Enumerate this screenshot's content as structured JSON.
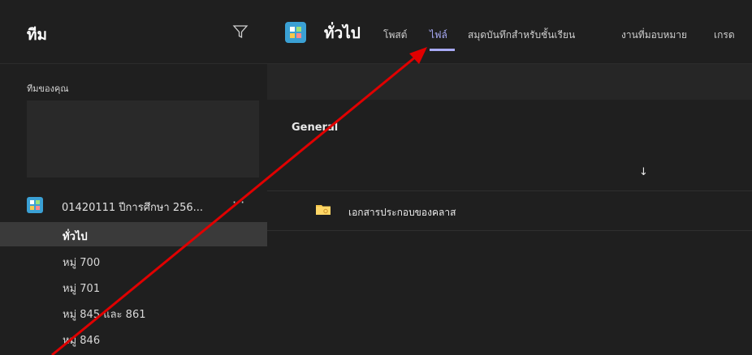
{
  "sidebar": {
    "title": "ทีม",
    "your_teams_label": "ทีมของคุณ",
    "team": {
      "name": "01420111 ปีการศึกษา 256...",
      "more": "···"
    },
    "channels": [
      {
        "label": "ทั่วไป",
        "active": true
      },
      {
        "label": "หมู่ 700",
        "active": false
      },
      {
        "label": "หมู่ 701",
        "active": false
      },
      {
        "label": "หมู่ 845 และ 861",
        "active": false
      },
      {
        "label": "หมู่ 846",
        "active": false
      }
    ]
  },
  "main": {
    "channel_title": "ทั่วไป",
    "tabs": [
      {
        "label": "โพสต์"
      },
      {
        "label": "ไฟล์",
        "active": true
      },
      {
        "label": "สมุดบันทึกสำหรับชั้นเรียน"
      },
      {
        "label": "งานที่มอบหมาย"
      },
      {
        "label": "เกรด"
      }
    ],
    "folder_title": "General",
    "sort_icon": "↓",
    "files": [
      {
        "name": "เอกสารประกอบของคลาส",
        "icon": "folder-icon"
      }
    ]
  },
  "colors": {
    "accent": "#a8aaf5",
    "annotation_arrow": "#e00000",
    "background": "#1f1f1f"
  }
}
